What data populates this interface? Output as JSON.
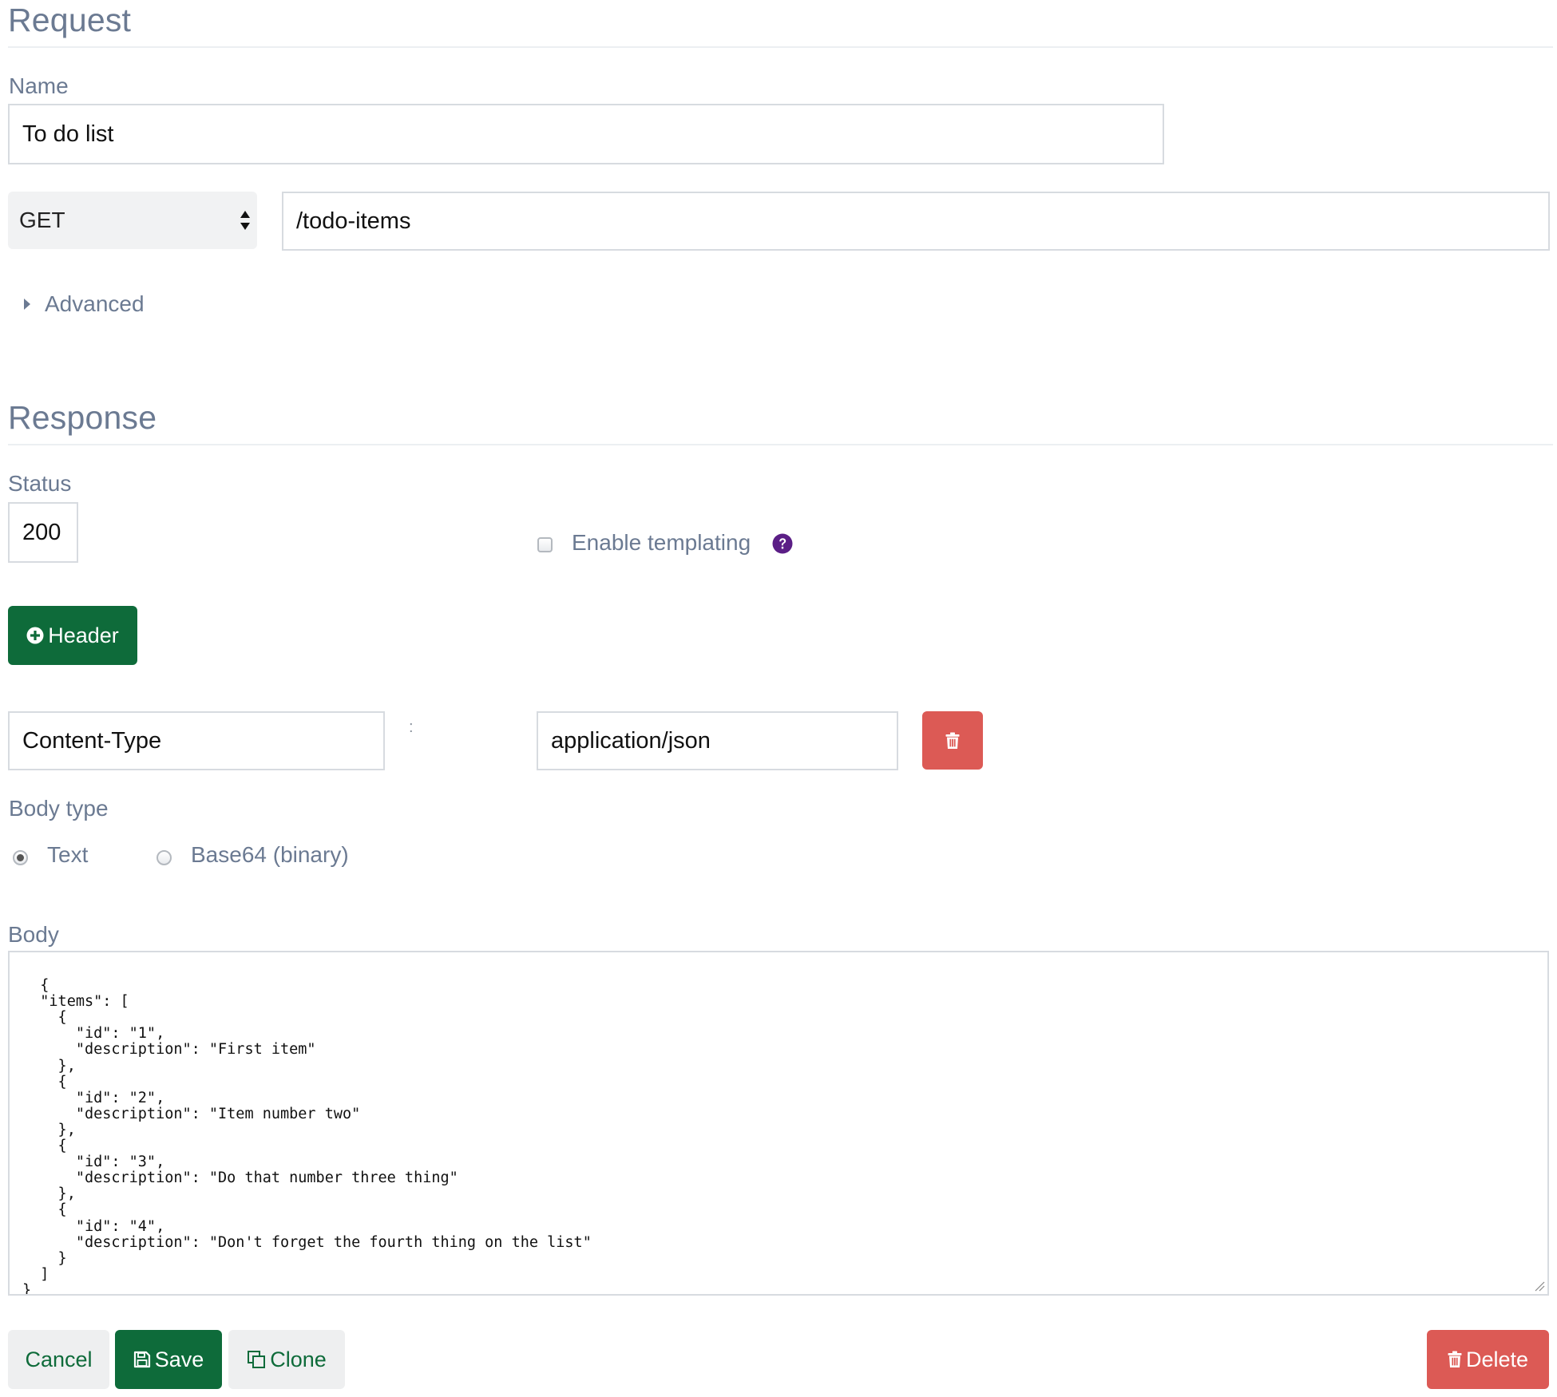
{
  "request": {
    "title": "Request",
    "name_label": "Name",
    "name_value": "To do list",
    "method": "GET",
    "path": "/todo-items",
    "advanced_label": "Advanced"
  },
  "response": {
    "title": "Response",
    "status_label": "Status",
    "status_value": "200",
    "templating_label": "Enable templating",
    "templating_checked": false,
    "add_header_label": "Header",
    "header": {
      "name": "Content-Type",
      "separator": ":",
      "value": "application/json"
    },
    "body_type_label": "Body type",
    "body_type_options": [
      "Text",
      "Base64 (binary)"
    ],
    "body_type_selected": "Text",
    "body_label": "Body",
    "body": "{\n  \"items\": [\n    {\n      \"id\": \"1\",\n      \"description\": \"First item\"\n    },\n    {\n      \"id\": \"2\",\n      \"description\": \"Item number two\"\n    },\n    {\n      \"id\": \"3\",\n      \"description\": \"Do that number three thing\"\n    },\n    {\n      \"id\": \"4\",\n      \"description\": \"Don't forget the fourth thing on the list\"\n    }\n  ]\n}"
  },
  "actions": {
    "cancel": "Cancel",
    "save": "Save",
    "clone": "Clone",
    "delete": "Delete"
  },
  "colors": {
    "primary_green": "#0e6b3a",
    "danger_red": "#dc5a55",
    "label_gray_blue": "#6b7a92",
    "help_purple": "#5b1e86"
  },
  "icons": {
    "method_select": "up-down-arrows-icon",
    "advanced": "caret-right-icon",
    "help": "question-circle-icon",
    "add_header": "plus-circle-icon",
    "remove_header": "trash-icon",
    "save": "floppy-disk-icon",
    "clone": "copy-icon",
    "delete": "trash-icon"
  }
}
